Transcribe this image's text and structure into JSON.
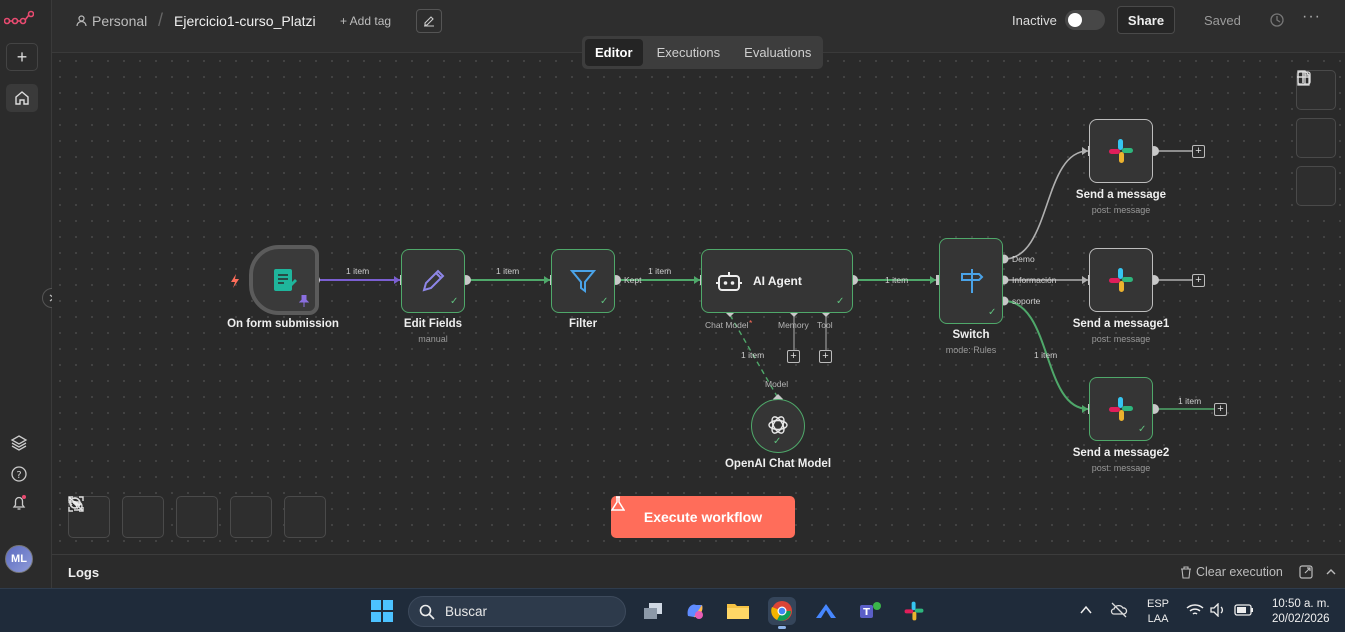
{
  "rail": {
    "add_label": "+",
    "avatar_initials": "ML"
  },
  "header": {
    "project": "Personal",
    "separator": "/",
    "workflow_name": "Ejercicio1-curso_Platzi",
    "add_tag": "+ Add tag",
    "active_state_label": "Inactive",
    "share_label": "Share",
    "save_state": "Saved",
    "more_label": "···"
  },
  "tabs": [
    "Editor",
    "Executions",
    "Evaluations"
  ],
  "nodes": {
    "trigger": {
      "label": "On form submission"
    },
    "edit_fields": {
      "label": "Edit Fields",
      "sub": "manual"
    },
    "filter": {
      "label": "Filter"
    },
    "ai_agent": {
      "label": "AI Agent",
      "ports": [
        "Chat Model",
        "*",
        "Memory",
        "Tool"
      ]
    },
    "openai": {
      "label": "OpenAI Chat Model",
      "port": "Model"
    },
    "switch": {
      "label": "Switch",
      "sub": "mode: Rules",
      "outputs": [
        "Demo",
        "Información",
        "soporte"
      ]
    },
    "msg1": {
      "label": "Send a message",
      "sub": "post: message"
    },
    "msg2": {
      "label": "Send a message1",
      "sub": "post: message"
    },
    "msg3": {
      "label": "Send a message2",
      "sub": "post: message"
    }
  },
  "connections": {
    "item_count": "1 item",
    "kept_label": "Kept"
  },
  "execute_label": "Execute workflow",
  "logs": {
    "title": "Logs",
    "clear_label": "Clear execution"
  },
  "taskbar": {
    "search_placeholder": "Buscar",
    "lang_line1": "ESP",
    "lang_line2": "LAA",
    "time": "10:50 a. m.",
    "date": "20/02/2026"
  },
  "colors": {
    "accent": "#ff6d5a",
    "success": "#4fa86a",
    "trigger_edge": "#7b5fd1"
  }
}
